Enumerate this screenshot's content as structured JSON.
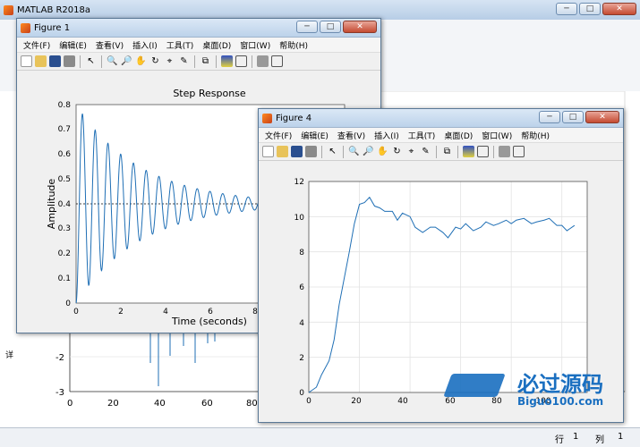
{
  "main_window": {
    "title": "MATLAB R2018a",
    "status": {
      "row_label": "行",
      "row_value": "1",
      "col_label": "列",
      "col_value": "1"
    },
    "bg_plot": {
      "yticks": [
        "-2",
        "-3"
      ],
      "xticks": [
        "0",
        "20",
        "40",
        "60",
        "80"
      ],
      "side_label": "详"
    }
  },
  "figure1": {
    "title": "Figure 1",
    "menus": [
      "文件(F)",
      "编辑(E)",
      "查看(V)",
      "插入(I)",
      "工具(T)",
      "桌面(D)",
      "窗口(W)",
      "帮助(H)"
    ],
    "chart_title": "Step Response",
    "xlabel": "Time (seconds)",
    "ylabel": "Amplitude",
    "yticks": [
      "0",
      "0.1",
      "0.2",
      "0.3",
      "0.4",
      "0.5",
      "0.6",
      "0.7",
      "0.8"
    ],
    "xticks": [
      "0",
      "2",
      "4",
      "6",
      "8"
    ]
  },
  "figure4": {
    "title": "Figure 4",
    "menus": [
      "文件(F)",
      "编辑(E)",
      "查看(V)",
      "插入(I)",
      "工具(T)",
      "桌面(D)",
      "窗口(W)",
      "帮助(H)"
    ],
    "yticks": [
      "0",
      "2",
      "4",
      "6",
      "8",
      "10",
      "12"
    ],
    "xticks": [
      "0",
      "20",
      "40",
      "60",
      "80",
      "100"
    ]
  },
  "watermark": {
    "line1": "必过源码",
    "line2": "Biguo100.com"
  },
  "chart_data": [
    {
      "type": "line",
      "title": "Step Response",
      "xlabel": "Time (seconds)",
      "ylabel": "Amplitude",
      "xlim": [
        0,
        8
      ],
      "ylim": [
        0,
        0.8
      ],
      "grid": false,
      "steady_state": 0.4,
      "series": [
        {
          "peak": 0.74,
          "period": 0.38,
          "decay": 0.52
        }
      ]
    },
    {
      "type": "line",
      "xlim": [
        0,
        110
      ],
      "ylim": [
        0,
        12
      ],
      "grid": true,
      "series": [
        {
          "x": [
            0,
            3,
            5,
            8,
            10,
            12,
            14,
            16,
            18,
            20,
            22,
            24,
            26,
            28,
            30,
            33,
            35,
            37,
            40,
            42,
            45,
            48,
            50,
            53,
            55,
            58,
            60,
            62,
            65,
            68,
            70,
            73,
            75,
            78,
            80,
            82,
            85,
            88,
            90,
            93,
            95,
            98,
            100,
            102,
            105
          ],
          "y": [
            0,
            0.3,
            1,
            1.8,
            3,
            5,
            6.5,
            8,
            9.6,
            10.7,
            10.8,
            11.1,
            10.6,
            10.5,
            10.3,
            10.3,
            9.8,
            10.2,
            10,
            9.4,
            9.1,
            9.4,
            9.4,
            9.1,
            8.8,
            9.4,
            9.3,
            9.6,
            9.2,
            9.4,
            9.7,
            9.5,
            9.6,
            9.8,
            9.6,
            9.8,
            9.9,
            9.6,
            9.7,
            9.8,
            9.9,
            9.5,
            9.5,
            9.2,
            9.5
          ]
        }
      ]
    }
  ]
}
